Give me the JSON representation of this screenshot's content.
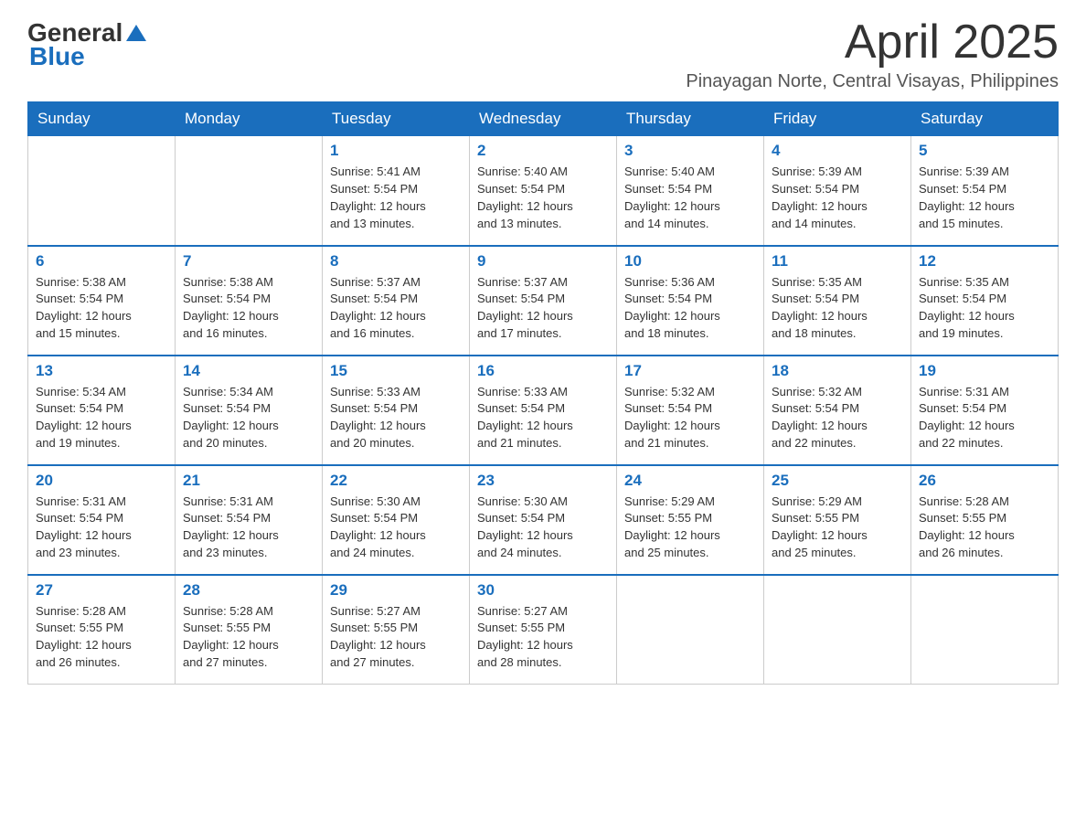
{
  "header": {
    "logo": {
      "general": "General",
      "blue": "Blue"
    },
    "title": "April 2025",
    "location": "Pinayagan Norte, Central Visayas, Philippines"
  },
  "weekdays": [
    "Sunday",
    "Monday",
    "Tuesday",
    "Wednesday",
    "Thursday",
    "Friday",
    "Saturday"
  ],
  "weeks": [
    [
      {
        "day": "",
        "info": ""
      },
      {
        "day": "",
        "info": ""
      },
      {
        "day": "1",
        "info": "Sunrise: 5:41 AM\nSunset: 5:54 PM\nDaylight: 12 hours\nand 13 minutes."
      },
      {
        "day": "2",
        "info": "Sunrise: 5:40 AM\nSunset: 5:54 PM\nDaylight: 12 hours\nand 13 minutes."
      },
      {
        "day": "3",
        "info": "Sunrise: 5:40 AM\nSunset: 5:54 PM\nDaylight: 12 hours\nand 14 minutes."
      },
      {
        "day": "4",
        "info": "Sunrise: 5:39 AM\nSunset: 5:54 PM\nDaylight: 12 hours\nand 14 minutes."
      },
      {
        "day": "5",
        "info": "Sunrise: 5:39 AM\nSunset: 5:54 PM\nDaylight: 12 hours\nand 15 minutes."
      }
    ],
    [
      {
        "day": "6",
        "info": "Sunrise: 5:38 AM\nSunset: 5:54 PM\nDaylight: 12 hours\nand 15 minutes."
      },
      {
        "day": "7",
        "info": "Sunrise: 5:38 AM\nSunset: 5:54 PM\nDaylight: 12 hours\nand 16 minutes."
      },
      {
        "day": "8",
        "info": "Sunrise: 5:37 AM\nSunset: 5:54 PM\nDaylight: 12 hours\nand 16 minutes."
      },
      {
        "day": "9",
        "info": "Sunrise: 5:37 AM\nSunset: 5:54 PM\nDaylight: 12 hours\nand 17 minutes."
      },
      {
        "day": "10",
        "info": "Sunrise: 5:36 AM\nSunset: 5:54 PM\nDaylight: 12 hours\nand 18 minutes."
      },
      {
        "day": "11",
        "info": "Sunrise: 5:35 AM\nSunset: 5:54 PM\nDaylight: 12 hours\nand 18 minutes."
      },
      {
        "day": "12",
        "info": "Sunrise: 5:35 AM\nSunset: 5:54 PM\nDaylight: 12 hours\nand 19 minutes."
      }
    ],
    [
      {
        "day": "13",
        "info": "Sunrise: 5:34 AM\nSunset: 5:54 PM\nDaylight: 12 hours\nand 19 minutes."
      },
      {
        "day": "14",
        "info": "Sunrise: 5:34 AM\nSunset: 5:54 PM\nDaylight: 12 hours\nand 20 minutes."
      },
      {
        "day": "15",
        "info": "Sunrise: 5:33 AM\nSunset: 5:54 PM\nDaylight: 12 hours\nand 20 minutes."
      },
      {
        "day": "16",
        "info": "Sunrise: 5:33 AM\nSunset: 5:54 PM\nDaylight: 12 hours\nand 21 minutes."
      },
      {
        "day": "17",
        "info": "Sunrise: 5:32 AM\nSunset: 5:54 PM\nDaylight: 12 hours\nand 21 minutes."
      },
      {
        "day": "18",
        "info": "Sunrise: 5:32 AM\nSunset: 5:54 PM\nDaylight: 12 hours\nand 22 minutes."
      },
      {
        "day": "19",
        "info": "Sunrise: 5:31 AM\nSunset: 5:54 PM\nDaylight: 12 hours\nand 22 minutes."
      }
    ],
    [
      {
        "day": "20",
        "info": "Sunrise: 5:31 AM\nSunset: 5:54 PM\nDaylight: 12 hours\nand 23 minutes."
      },
      {
        "day": "21",
        "info": "Sunrise: 5:31 AM\nSunset: 5:54 PM\nDaylight: 12 hours\nand 23 minutes."
      },
      {
        "day": "22",
        "info": "Sunrise: 5:30 AM\nSunset: 5:54 PM\nDaylight: 12 hours\nand 24 minutes."
      },
      {
        "day": "23",
        "info": "Sunrise: 5:30 AM\nSunset: 5:54 PM\nDaylight: 12 hours\nand 24 minutes."
      },
      {
        "day": "24",
        "info": "Sunrise: 5:29 AM\nSunset: 5:55 PM\nDaylight: 12 hours\nand 25 minutes."
      },
      {
        "day": "25",
        "info": "Sunrise: 5:29 AM\nSunset: 5:55 PM\nDaylight: 12 hours\nand 25 minutes."
      },
      {
        "day": "26",
        "info": "Sunrise: 5:28 AM\nSunset: 5:55 PM\nDaylight: 12 hours\nand 26 minutes."
      }
    ],
    [
      {
        "day": "27",
        "info": "Sunrise: 5:28 AM\nSunset: 5:55 PM\nDaylight: 12 hours\nand 26 minutes."
      },
      {
        "day": "28",
        "info": "Sunrise: 5:28 AM\nSunset: 5:55 PM\nDaylight: 12 hours\nand 27 minutes."
      },
      {
        "day": "29",
        "info": "Sunrise: 5:27 AM\nSunset: 5:55 PM\nDaylight: 12 hours\nand 27 minutes."
      },
      {
        "day": "30",
        "info": "Sunrise: 5:27 AM\nSunset: 5:55 PM\nDaylight: 12 hours\nand 28 minutes."
      },
      {
        "day": "",
        "info": ""
      },
      {
        "day": "",
        "info": ""
      },
      {
        "day": "",
        "info": ""
      }
    ]
  ]
}
